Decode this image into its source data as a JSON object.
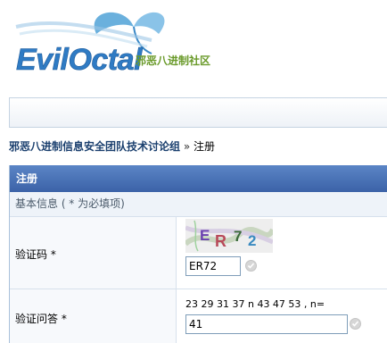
{
  "logo": {
    "wordmark": "EvilOctal",
    "tagline": "邪恶八进制社区"
  },
  "breadcrumb": {
    "forum": "邪恶八进制信息安全团队技术讨论组",
    "separator": "»",
    "current": "注册"
  },
  "panel": {
    "header": "注册",
    "section": "基本信息 ( * 为必填项)"
  },
  "captcha": {
    "label": "验证码 *",
    "image_text": "ER72",
    "value": "ER72"
  },
  "question": {
    "label": "验证问答 *",
    "text": "23 29 31 37 n 43 47 53 , n=",
    "value": "41"
  },
  "colors": {
    "header_bg": "#4a73b8",
    "link": "#1a3f6e",
    "logo_blue": "#2f7bc4",
    "logo_green": "#6a9a2a"
  }
}
